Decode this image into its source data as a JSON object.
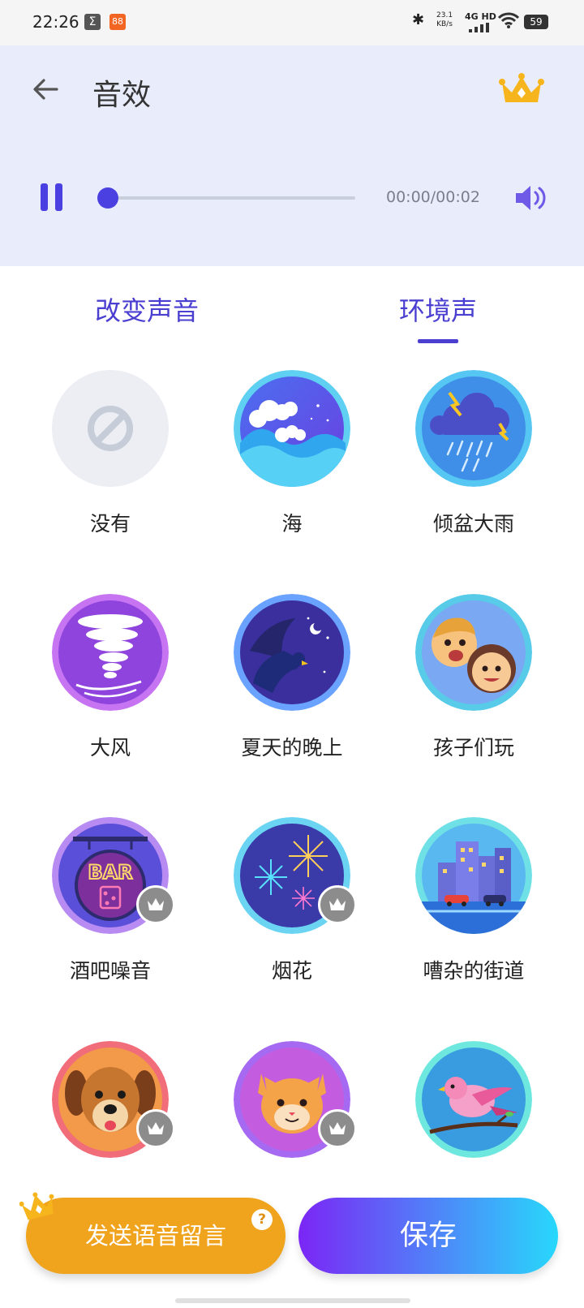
{
  "status_bar": {
    "time": "22:26",
    "app_icon_1": "Σ",
    "app_icon_2": "88",
    "net_speed_value": "23.1",
    "net_speed_unit": "KB/s",
    "network": "4G HD",
    "battery": "59"
  },
  "header": {
    "title": "音效",
    "back_icon": "arrow-left-icon",
    "vip_icon": "crown-icon"
  },
  "player": {
    "state": "playing",
    "time_readout": "00:00/00:02",
    "progress": 0.03
  },
  "tabs": [
    {
      "label": "改变声音",
      "selected": false
    },
    {
      "label": "环境声",
      "selected": true
    }
  ],
  "effects": [
    {
      "label": "没有",
      "icon": "none-icon",
      "premium": false
    },
    {
      "label": "海",
      "icon": "sea-waves-icon",
      "premium": false
    },
    {
      "label": "倾盆大雨",
      "icon": "heavy-rain-icon",
      "premium": false
    },
    {
      "label": "大风",
      "icon": "tornado-icon",
      "premium": false
    },
    {
      "label": "夏天的晚上",
      "icon": "summer-night-icon",
      "premium": false
    },
    {
      "label": "孩子们玩",
      "icon": "children-playing-icon",
      "premium": false
    },
    {
      "label": "酒吧噪音",
      "icon": "bar-noise-icon",
      "premium": true,
      "sign_text": "BAR"
    },
    {
      "label": "烟花",
      "icon": "fireworks-icon",
      "premium": true
    },
    {
      "label": "嘈杂的街道",
      "icon": "noisy-street-icon",
      "premium": false
    },
    {
      "label": "",
      "icon": "dog-icon",
      "premium": true
    },
    {
      "label": "",
      "icon": "cat-icon",
      "premium": true
    },
    {
      "label": "",
      "icon": "bird-icon",
      "premium": false
    }
  ],
  "actions": {
    "send_label": "发送语音留言",
    "help_badge": "?",
    "save_label": "保存"
  },
  "colors": {
    "accent": "#4a3fd0",
    "header_bg": "#e9edfb",
    "send_button": "#f0a31c",
    "save_gradient_start": "#7b26f5",
    "save_gradient_end": "#28d8fb"
  }
}
